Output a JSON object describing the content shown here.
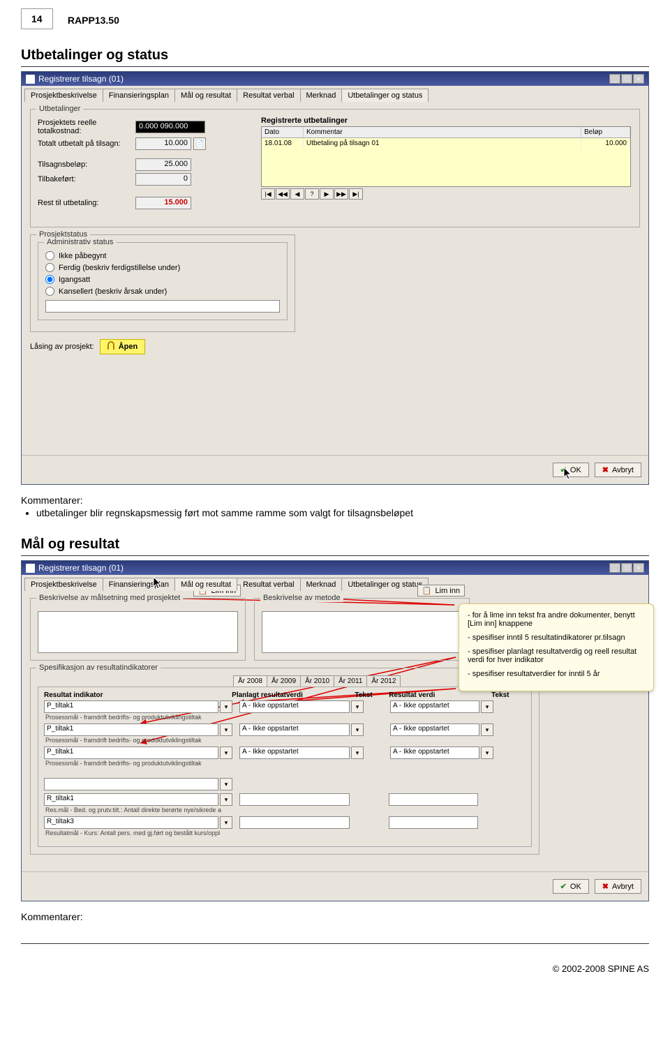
{
  "page": {
    "number": "14",
    "ref": "RAPP13.50"
  },
  "section1": {
    "title": "Utbetalinger og status",
    "window_title": "Registrerer tilsagn  (01)",
    "tabs": [
      "Prosjektbeskrivelse",
      "Finansieringsplan",
      "Mål og resultat",
      "Resultat verbal",
      "Merknad",
      "Utbetalinger og status"
    ],
    "active_tab": 5,
    "utbetalinger": {
      "legend": "Utbetalinger",
      "totalkost_label": "Prosjektets reelle totalkostnad:",
      "totalkost_value": "0.000 090.000",
      "totalt_label": "Totalt utbetalt på tilsagn:",
      "totalt_value": "10.000",
      "tilsagnsbelop_label": "Tilsagnsbeløp:",
      "tilsagnsbelop_value": "25.000",
      "tilbakefort_label": "Tilbakeført:",
      "tilbakefort_value": "0",
      "rest_label": "Rest til utbetaling:",
      "rest_value": "15.000",
      "registrerte_heading": "Registrerte utbetalinger",
      "grid_cols": [
        "Dato",
        "Kommentar",
        "Beløp"
      ],
      "grid_row": {
        "dato": "18.01.08",
        "kommentar": "Utbetaling på tilsagn 01",
        "belop": "10.000"
      },
      "nav": [
        "|◀",
        "◀◀",
        "◀",
        "?",
        "▶",
        "▶▶",
        "▶|"
      ]
    },
    "prosjektstatus": {
      "legend": "Prosjektstatus",
      "admin_legend": "Administrativ status",
      "radios": [
        {
          "label": "Ikke påbegynt",
          "checked": false
        },
        {
          "label": "Ferdig (beskriv ferdigstillelse under)",
          "checked": false
        },
        {
          "label": "Igangsatt",
          "checked": true
        },
        {
          "label": "Kansellert (beskriv årsak under)",
          "checked": false
        }
      ],
      "lasing_label": "Låsing av prosjekt:",
      "lasing_value": "Åpen"
    },
    "buttons": {
      "ok": "OK",
      "avbryt": "Avbryt"
    }
  },
  "comments1": {
    "label": "Kommentarer:",
    "text": "utbetalinger blir regnskapsmessig ført mot samme ramme som valgt for tilsagnsbeløpet"
  },
  "section2": {
    "title": "Mål og resultat",
    "window_title": "Registrerer tilsagn  (01)",
    "tabs": [
      "Prosjektbeskrivelse",
      "Finansieringsplan",
      "Mål og resultat",
      "Resultat verbal",
      "Merknad",
      "Utbetalinger og status"
    ],
    "active_tab": 2,
    "beskrivelse_legend": "Beskrivelse av målsetning med prosjektet",
    "metode_legend": "Beskrivelse av metode",
    "liminn": "Lim inn",
    "callout": {
      "p1": "- for å lime inn tekst fra andre dokumenter, benytt [Lim inn] knappene",
      "p2": "- spesifiser inntil 5 resultatindikatorer pr.tilsagn",
      "p3": "- spesifiser planlagt resultatverdig og reell resultat verdi for hver indikator",
      "p4": "- spesifiser resultatverdier for inntil 5 år"
    },
    "spesifikasjon_legend": "Spesifikasjon av resultatindikatorer",
    "year_tabs": [
      "År 2008",
      "År 2009",
      "År 2010",
      "År 2011",
      "År 2012"
    ],
    "active_year": 0,
    "spec_headers": [
      "Resultat indikator",
      "Planlagt resultatverdi",
      "Tekst",
      "Resultat verdi",
      "Tekst"
    ],
    "combo_value": "A - Ikke oppstartet",
    "indicators": [
      {
        "name": "P_tiltak1",
        "desc": "Prosessmål - framdrift bedrifts- og produktutviklingstiltak",
        "combos": true
      },
      {
        "name": "P_tiltak1",
        "desc": "Prosessmål - framdrift bedrifts- og produktutviklingstiltak",
        "combos": true
      },
      {
        "name": "P_tiltak1",
        "desc": "Prosessmål - framdrift bedrifts- og produktutviklingstiltak",
        "combos": true
      },
      {
        "name": "",
        "desc": "",
        "combos": false,
        "blankgap": true
      },
      {
        "name": "R_tiltak1",
        "desc": "Res.mål - Bed. og prutv.tilt.: Antall direkte berørte nye/sikrede a",
        "combos": false
      },
      {
        "name": "R_tiltak3",
        "desc": "Resultatmål - Kurs: Antall pers. med gj.ført og bestått kurs/oppl",
        "combos": false
      }
    ],
    "buttons": {
      "ok": "OK",
      "avbryt": "Avbryt"
    }
  },
  "comments2": {
    "label": "Kommentarer:"
  },
  "footer": "© 2002-2008  SPINE AS"
}
